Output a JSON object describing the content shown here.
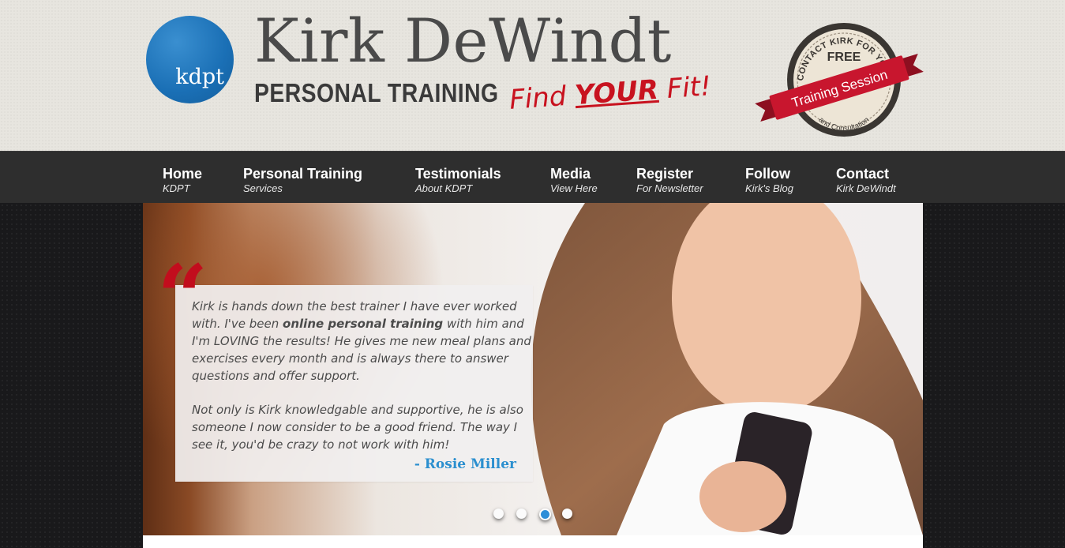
{
  "header": {
    "logo_text": "kdpt",
    "brand_name": "Kirk DeWindt",
    "brand_sub": "PERSONAL TRAINING",
    "tagline_pre": "Find ",
    "tagline_emph": "YOUR",
    "tagline_post": " Fit!",
    "badge": {
      "arc_text": "CONTACT KIRK FOR YOUR",
      "free": "FREE",
      "ribbon": "Training Session",
      "bottom": "and Consultation",
      "ribbon_color": "#c8162e"
    }
  },
  "nav": {
    "items": [
      {
        "title": "Home",
        "sub": "KDPT"
      },
      {
        "title": "Personal Training",
        "sub": "Services"
      },
      {
        "title": "Testimonials",
        "sub": "About KDPT"
      },
      {
        "title": "Media",
        "sub": "View Here"
      },
      {
        "title": "Register",
        "sub": "For Newsletter"
      },
      {
        "title": "Follow",
        "sub": "Kirk's Blog"
      },
      {
        "title": "Contact",
        "sub": "Kirk DeWindt"
      }
    ]
  },
  "slider": {
    "quote_mark": "“",
    "q1_pre": "Kirk is hands down the best trainer I have ever worked with. I've been ",
    "q1_bold": "online personal training",
    "q1_post": " with him and I'm LOVING the results! He gives me new meal plans and exercises every month and is always there to answer questions and offer support.",
    "q2": "Not only is Kirk knowledgable and supportive, he is also someone I now consider to be a good friend. The way I see it, you'd be crazy to not work with him!",
    "author": "- Rosie Miller",
    "dots": {
      "count": 4,
      "active": 3
    },
    "accent_color": "#2b8fcf"
  }
}
